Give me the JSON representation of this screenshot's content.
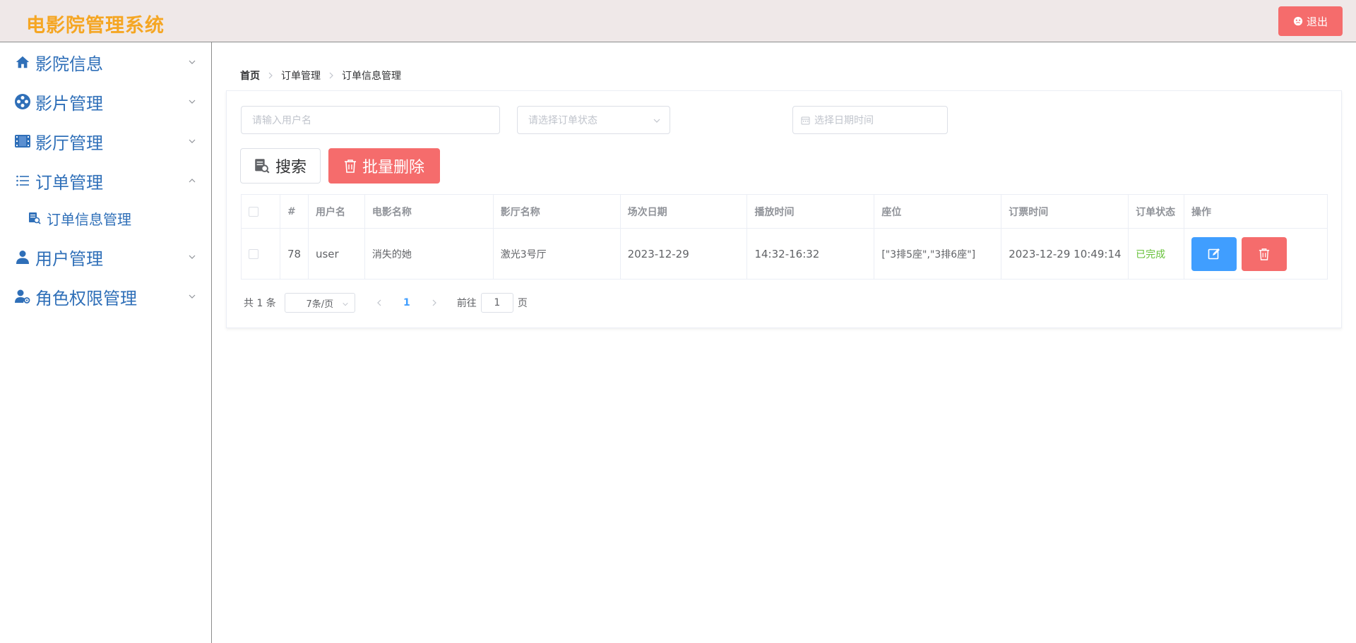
{
  "header": {
    "app_title": "电影院管理系统",
    "logout_label": "退出"
  },
  "colors": {
    "title": "#f5a623",
    "menu_text": "#2f6fb8",
    "danger": "#f56c6c",
    "primary": "#409eff",
    "success": "#67c23a"
  },
  "sidebar": {
    "items": [
      {
        "label": "影院信息",
        "icon": "home-icon",
        "expanded": false
      },
      {
        "label": "影片管理",
        "icon": "film-reel-icon",
        "expanded": false
      },
      {
        "label": "影厅管理",
        "icon": "film-strip-icon",
        "expanded": false
      },
      {
        "label": "订单管理",
        "icon": "list-icon",
        "expanded": true
      },
      {
        "label": "用户管理",
        "icon": "user-icon",
        "expanded": false
      },
      {
        "label": "角色权限管理",
        "icon": "user-settings-icon",
        "expanded": false
      }
    ],
    "sub_items": [
      {
        "label": "订单信息管理",
        "icon": "document-search-icon"
      }
    ]
  },
  "breadcrumb": [
    "首页",
    "订单管理",
    "订单信息管理"
  ],
  "filters": {
    "username_placeholder": "请输入用户名",
    "status_placeholder": "请选择订单状态",
    "date_placeholder": "选择日期时间"
  },
  "toolbar": {
    "search_label": "搜索",
    "batch_delete_label": "批量删除"
  },
  "table": {
    "headers": [
      "#",
      "用户名",
      "电影名称",
      "影厅名称",
      "场次日期",
      "播放时间",
      "座位",
      "订票时间",
      "订单状态",
      "操作"
    ],
    "rows": [
      {
        "id": "78",
        "username": "user",
        "movie": "消失的她",
        "hall": "激光3号厅",
        "date": "2023-12-29",
        "time": "14:32-16:32",
        "seats": "[\"3排5座\",\"3排6座\"]",
        "booked_at": "2023-12-29 10:49:14",
        "status": "已完成"
      }
    ]
  },
  "pagination": {
    "total": "共 1 条",
    "page_size": "7条/页",
    "current_page": "1",
    "goto_prefix": "前往",
    "goto_value": "1",
    "goto_suffix": "页"
  }
}
